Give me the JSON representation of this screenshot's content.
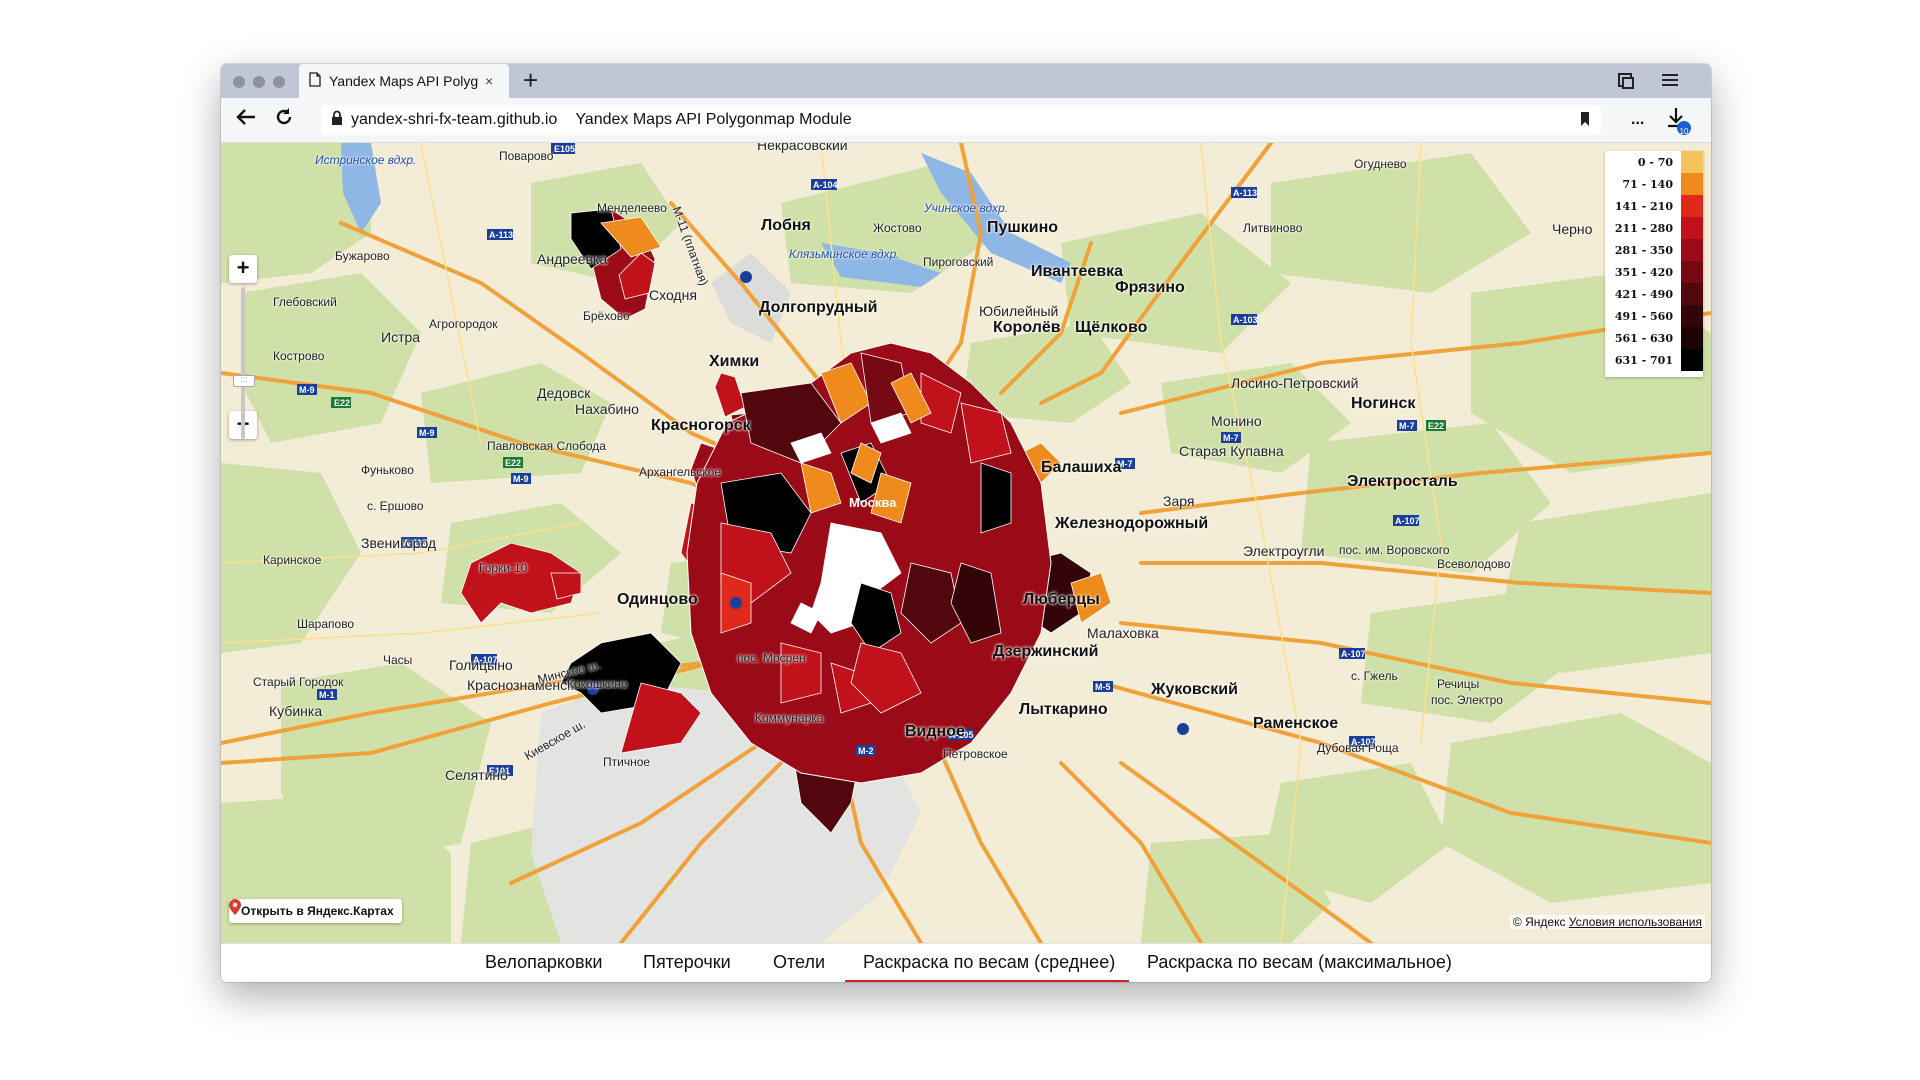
{
  "browser": {
    "tab_title": "Yandex Maps API Polyg",
    "tab_close": "×",
    "new_tab": "+",
    "url_domain": "yandex-shri-fx-team.github.io",
    "page_title": "Yandex Maps API Polygonmap Module",
    "more_label": "...",
    "downloads_count": "10"
  },
  "map": {
    "zoom_in": "+",
    "zoom_out": "−",
    "labels": {
      "nekrasovsky": "Некрасовский",
      "istra_res": "Истринское вдхр.",
      "povarovo": "Поварово",
      "mendeleevo": "Менделеево",
      "lobnya": "Лобня",
      "zhostovo": "Жостово",
      "uchinskoe": "Учинское вдхр.",
      "pushkino": "Пушкино",
      "ogudnevo": "Огуднево",
      "litvinovo": "Литвиново",
      "chern": "Черно",
      "buzharovo": "Бужарово",
      "andreevka": "Андреевка",
      "klyazminskoe": "Клязьминское вдхр.",
      "pirogovsky": "Пироговский",
      "ivanteevka": "Ивантеевка",
      "fryazino": "Фрязино",
      "skhodnya": "Сходня",
      "glebovsky": "Глебовский",
      "yubileyny": "Юбилейный",
      "korolev": "Королёв",
      "shchelkovo": "Щёлково",
      "istra": "Истра",
      "agrogorodok": "Агрогородок",
      "brekhovo": "Брёхово",
      "dolgoprudny": "Долгопрудный",
      "kostrovo": "Кострово",
      "khimki": "Химки",
      "losino": "Лосино-Петровский",
      "dedovsk": "Дедовск",
      "nakhabino": "Нахабино",
      "noginsk": "Ногинск",
      "krasnogorsk": "Красногорск",
      "monino": "Монино",
      "pavlovskaya": "Павловская Слобода",
      "staraya_kupavna": "Старая Купавна",
      "funkovo": "Фуньково",
      "arkhangelskoe": "Архангельское",
      "balashikha": "Балашиха",
      "elektrostal": "Электросталь",
      "s_ershovo": "с. Ершово",
      "zarya": "Заря",
      "zheleznodorozhny": "Железнодорожный",
      "zvenigorod": "Звенигород",
      "karinskoe": "Каринское",
      "gorki": "Горки-10",
      "elektrougli": "Электроугли",
      "vorovskogo": "пос. им. Воровского",
      "vsevolodovo": "Всеволодово",
      "odintsovo": "Одинцово",
      "lyubertsy": "Люберцы",
      "sharapovo": "Шарапово",
      "malakhovka": "Малаховка",
      "chasy": "Часы",
      "golitsyno": "Голицыно",
      "dzerzhinsky": "Дзержинский",
      "staryy_gorodok": "Старый Городок",
      "krasnoznamensk": "Краснознаменск",
      "kokoshkino": "Кокошкино",
      "zhukovsky": "Жуковский",
      "s_gzhel": "с. Гжель",
      "rechitsy": "Речицы",
      "pos_elektro": "пос. Электро",
      "kubinka": "Кубинка",
      "kommunarka": "Коммунарка",
      "lytkarino": "Лыткарино",
      "ramenskoe": "Раменское",
      "vidnoe": "Видное",
      "petrovskoe": "Петровское",
      "dubovaya_roshcha": "Дубовая Роща",
      "ptichnoe": "Птичное",
      "selyatino": "Селятино",
      "pos_mosr": "пос. Мосрен",
      "moskva": "Москва",
      "minsk_sh": "Минское ш.",
      "kievskoe_sh": "Киевское ш.",
      "m11": "М-11 (платная)"
    },
    "open_in_yandex": "Открыть в Яндекс.Картах",
    "copyright": "© Яндекс",
    "terms": "Условия использования"
  },
  "legend": [
    {
      "range": "0 - 70",
      "color": "#f5c35b"
    },
    {
      "range": "71 - 140",
      "color": "#ef8a1d"
    },
    {
      "range": "141 - 210",
      "color": "#e0291b"
    },
    {
      "range": "211 - 280",
      "color": "#c1121c"
    },
    {
      "range": "281 - 350",
      "color": "#9b0a17"
    },
    {
      "range": "351 - 420",
      "color": "#760812"
    },
    {
      "range": "421 - 490",
      "color": "#52060e"
    },
    {
      "range": "491 - 560",
      "color": "#330408"
    },
    {
      "range": "561 - 630",
      "color": "#1c0205"
    },
    {
      "range": "631 - 701",
      "color": "#000000"
    }
  ],
  "bottom_tabs": [
    {
      "label": "Велопарковки"
    },
    {
      "label": "Пятерочки"
    },
    {
      "label": "Отели"
    },
    {
      "label": "Раскраска по весам (среднее)",
      "active": true
    },
    {
      "label": "Раскраска по весам (максимальное)"
    }
  ],
  "colors": {
    "active_tab": "#d2232a",
    "road_major": "#f0a23a",
    "forest": "#cfe0a8",
    "water": "#8fb7e5"
  }
}
